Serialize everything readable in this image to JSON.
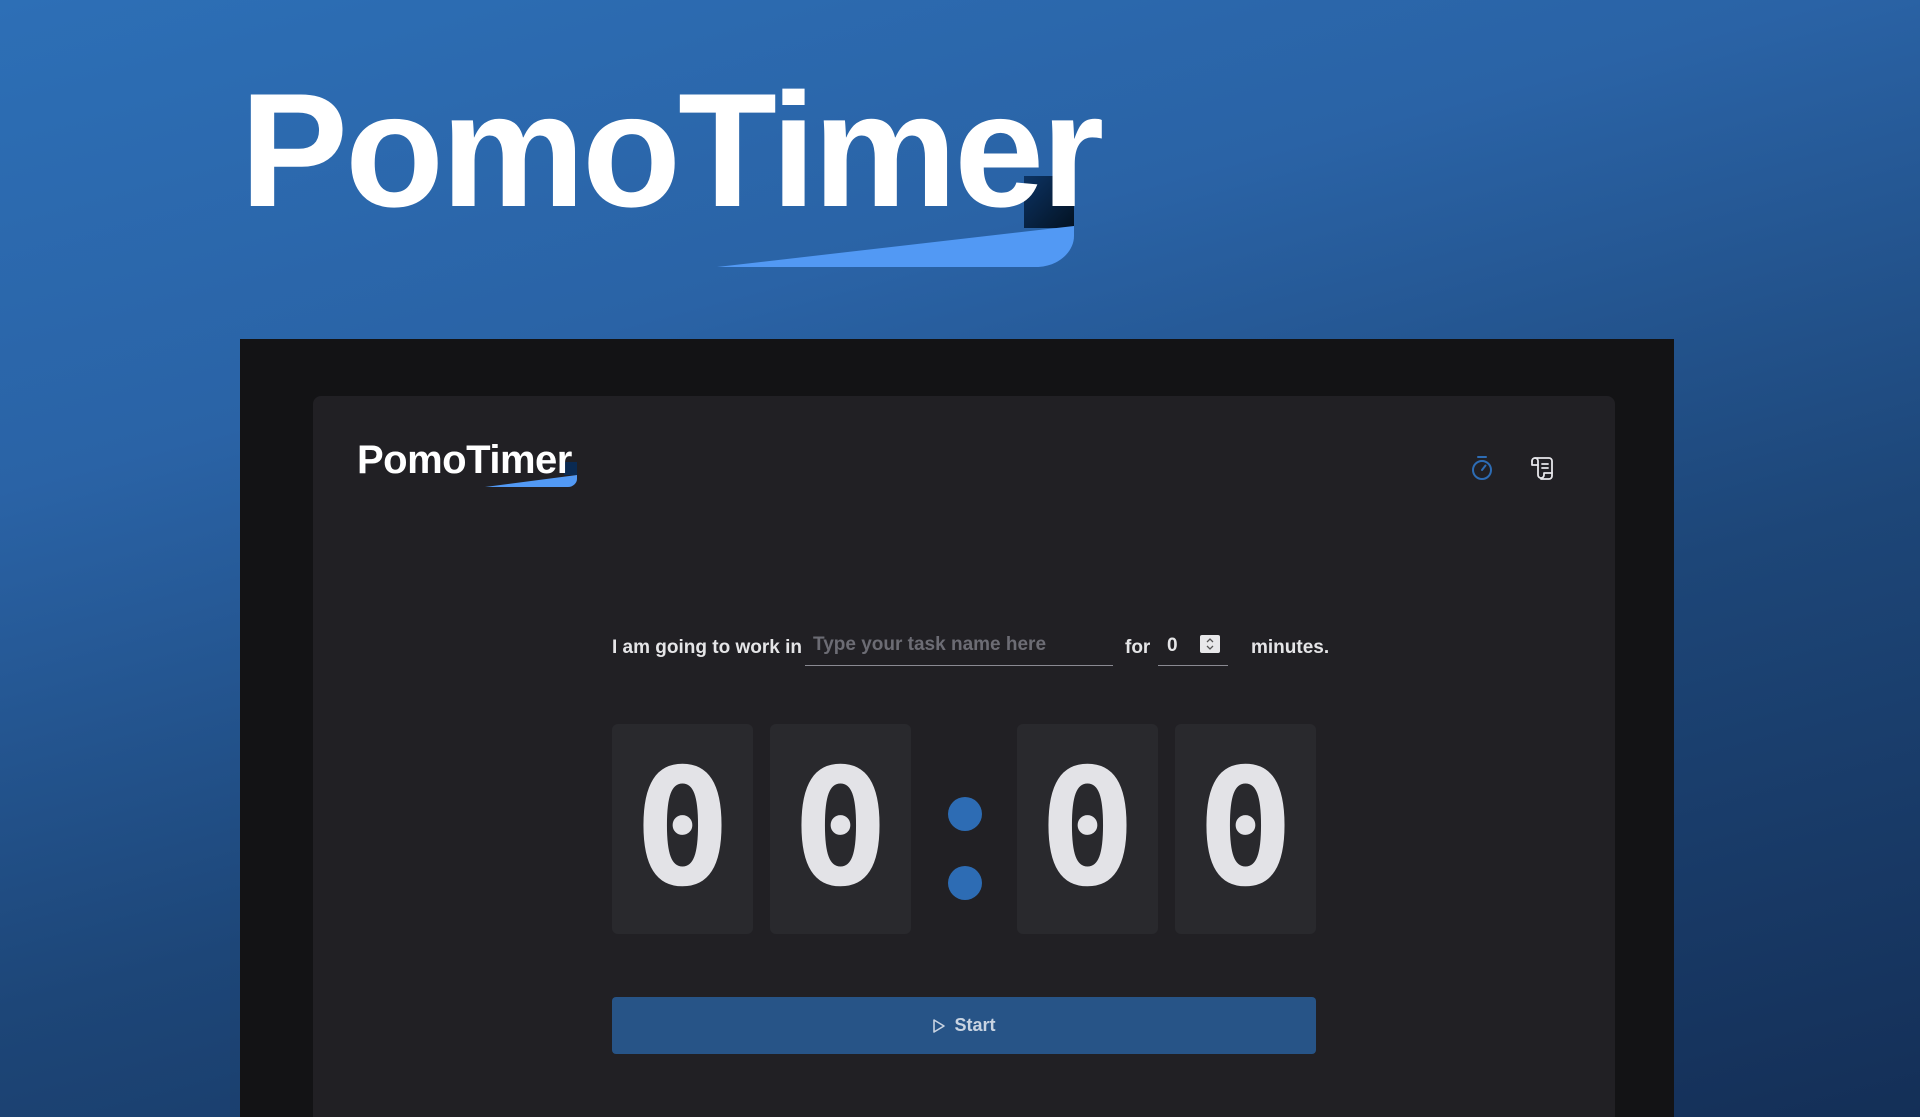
{
  "hero": {
    "title": "PomoTimer"
  },
  "app": {
    "brand": "PomoTimer",
    "nav": {
      "timer_icon": "stopwatch-icon",
      "history_icon": "scroll-icon"
    },
    "task": {
      "prefix": "I am going to work in",
      "placeholder": "Type your task name here",
      "value": "",
      "for_label": "for",
      "minutes_value": "0",
      "suffix": "minutes."
    },
    "timer": {
      "digits": [
        "0",
        "0",
        "0",
        "0"
      ],
      "separator": ":"
    },
    "start_label": "Start",
    "start_icon": "play-icon"
  },
  "colors": {
    "accent": "#2d6cb4",
    "accent_light": "#5299f4",
    "frame": "#131315",
    "card": "#212024",
    "digit_bg": "#29292d",
    "button": "#275487"
  }
}
